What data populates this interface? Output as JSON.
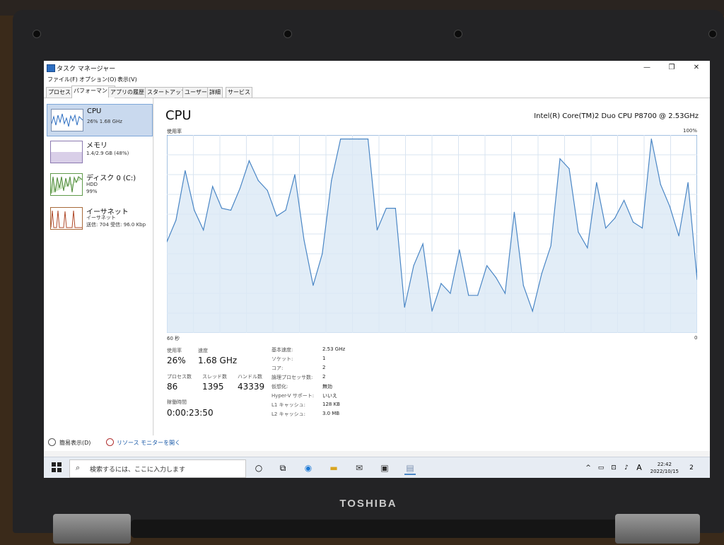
{
  "window": {
    "title": "タスク マネージャー",
    "controls": {
      "minimize": "—",
      "maximize": "❐",
      "close": "✕"
    }
  },
  "menu": [
    "ファイル(F)",
    "オプション(O)",
    "表示(V)"
  ],
  "tabs": [
    "プロセス",
    "パフォーマンス",
    "アプリの履歴",
    "スタートアップ",
    "ユーザー",
    "詳細",
    "サービス"
  ],
  "active_tab": "パフォーマンス",
  "sidebar": {
    "items": [
      {
        "title": "CPU",
        "lines": [
          "26%  1.68 GHz"
        ]
      },
      {
        "title": "メモリ",
        "lines": [
          "1.4/2.9 GB (48%)"
        ]
      },
      {
        "title": "ディスク 0 (C:)",
        "lines": [
          "HDD",
          "99%"
        ]
      },
      {
        "title": "イーサネット",
        "lines": [
          "イーサネット",
          "送信: 704  受信: 96.0 Kbp"
        ]
      }
    ]
  },
  "main": {
    "title": "CPU",
    "model": "Intel(R) Core(TM)2 Duo CPU P8700 @ 2.53GHz",
    "graph_ylabel": "使用率",
    "graph_ymax_label": "100%",
    "graph_xleft_label": "60 秒",
    "graph_xright_label": "0"
  },
  "stats": {
    "usage_label": "使用率",
    "usage_value": "26%",
    "speed_label": "速度",
    "speed_value": "1.68 GHz",
    "processes_label": "プロセス数",
    "processes_value": "86",
    "threads_label": "スレッド数",
    "threads_value": "1395",
    "handles_label": "ハンドル数",
    "handles_value": "43339",
    "uptime_label": "稼働時間",
    "uptime_value": "0:00:23:50"
  },
  "info": [
    {
      "label": "基本速度:",
      "value": "2.53 GHz"
    },
    {
      "label": "ソケット:",
      "value": "1"
    },
    {
      "label": "コア:",
      "value": "2"
    },
    {
      "label": "論理プロセッサ数:",
      "value": "2"
    },
    {
      "label": "仮想化:",
      "value": "無効"
    },
    {
      "label": "Hyper-V サポート:",
      "value": "いいえ"
    },
    {
      "label": "L1 キャッシュ:",
      "value": "128 KB"
    },
    {
      "label": "L2 キャッシュ:",
      "value": "3.0 MB"
    }
  ],
  "bottom": {
    "fewer_details": "簡易表示(D)",
    "resource_monitor": "リソース モニターを開く"
  },
  "taskbar": {
    "search_placeholder": "検索するには、ここに入力します",
    "time": "22:42",
    "date": "2022/10/15",
    "ime": "A",
    "notifications": "2"
  },
  "laptop": {
    "brand": "TOSHIBA"
  },
  "chart_data": {
    "type": "area",
    "ylabel": "使用率",
    "ylim": [
      0,
      100
    ],
    "xlim": [
      60,
      0
    ],
    "color": "#4a86c5",
    "values": [
      46,
      57,
      82,
      62,
      52,
      74,
      63,
      62,
      73,
      87,
      77,
      72,
      59,
      62,
      80,
      47,
      24,
      40,
      77,
      98,
      98,
      98,
      98,
      52,
      63,
      63,
      13,
      34,
      45,
      11,
      25,
      20,
      42,
      19,
      19,
      34,
      28,
      20,
      61,
      24,
      11,
      30,
      44,
      88,
      83,
      51,
      43,
      76,
      53,
      58,
      67,
      56,
      53,
      98,
      75,
      64,
      49,
      76,
      27
    ]
  }
}
